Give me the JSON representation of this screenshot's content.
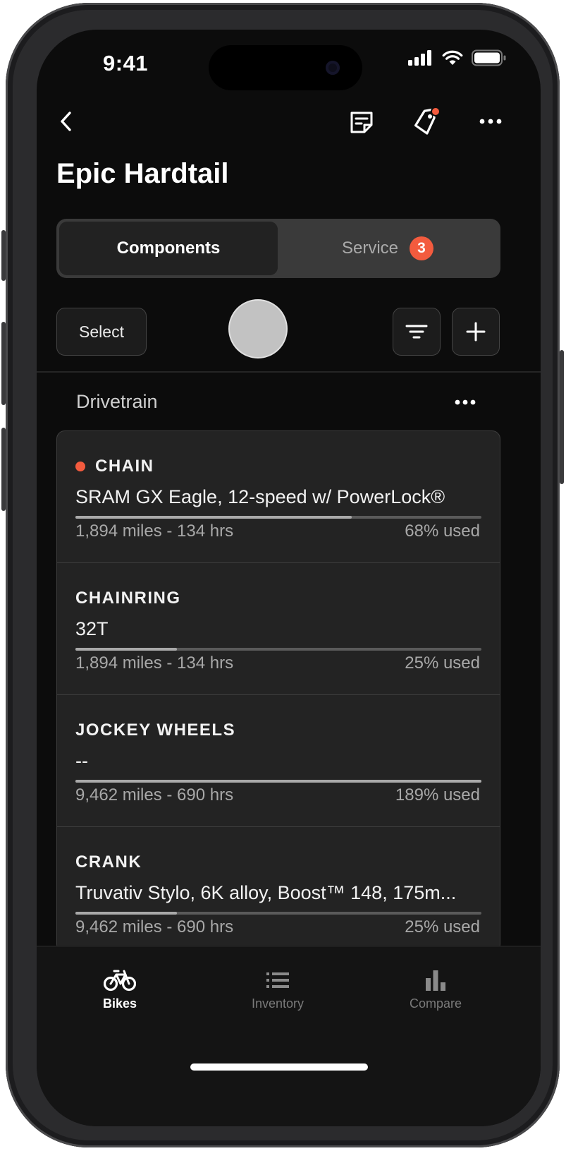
{
  "status_bar": {
    "time": "9:41"
  },
  "header": {
    "title": "Epic Hardtail"
  },
  "segment": {
    "active_label": "Components",
    "inactive_label": "Service",
    "inactive_badge": "3"
  },
  "toolbar": {
    "select_label": "Select"
  },
  "section": {
    "title": "Drivetrain"
  },
  "components": [
    {
      "name": "CHAIN",
      "description": "SRAM GX Eagle, 12-speed w/ PowerLock®",
      "usage": "1,894 miles - 134 hrs",
      "percent_label": "68% used",
      "used_fraction": 0.68,
      "alert": true
    },
    {
      "name": "CHAINRING",
      "description": "32T",
      "usage": "1,894 miles - 134 hrs",
      "percent_label": "25% used",
      "used_fraction": 0.25,
      "alert": false
    },
    {
      "name": "JOCKEY WHEELS",
      "description": "--",
      "usage": "9,462 miles - 690 hrs",
      "percent_label": "189% used",
      "used_fraction": 1.89,
      "alert": false
    },
    {
      "name": "CRANK",
      "description": "Truvativ Stylo, 6K alloy, Boost™ 148, 175m...",
      "usage": "9,462 miles - 690 hrs",
      "percent_label": "25% used",
      "used_fraction": 0.25,
      "alert": false
    }
  ],
  "tabs": [
    {
      "label": "Bikes",
      "icon": "bike-icon",
      "active": true
    },
    {
      "label": "Inventory",
      "icon": "list-icon",
      "active": false
    },
    {
      "label": "Compare",
      "icon": "bar-chart-icon",
      "active": false
    }
  ],
  "colors": {
    "alert": "#f35b3e",
    "background": "#0c0c0c",
    "card": "#232323"
  }
}
